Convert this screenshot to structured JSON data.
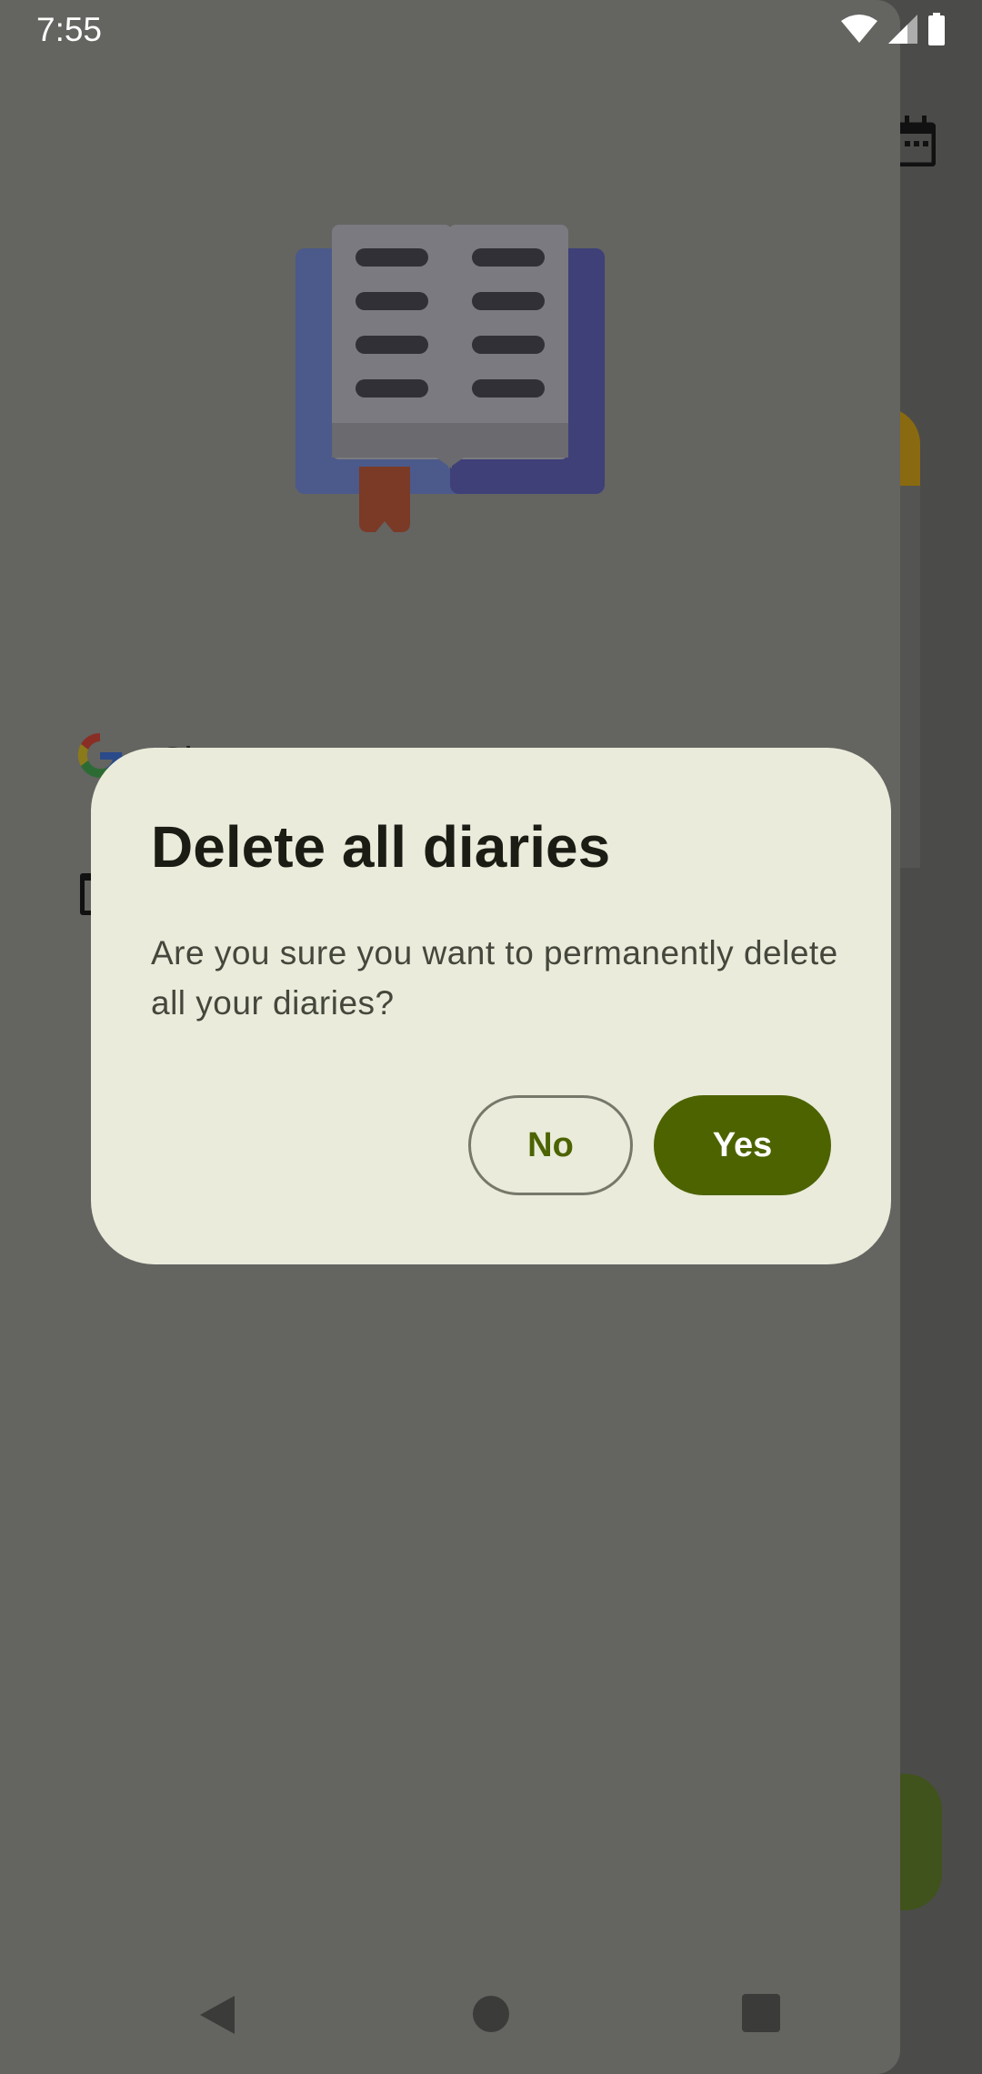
{
  "status_bar": {
    "time": "7:55",
    "icons": [
      "wifi-icon",
      "cell-signal-icon",
      "battery-icon"
    ]
  },
  "drawer": {
    "signout_label": "Sign out"
  },
  "dialog": {
    "title": "Delete all diaries",
    "message": "Are you sure you want to permanently delete all your diaries?",
    "no_label": "No",
    "yes_label": "Yes"
  },
  "nav_bar": {
    "icons": [
      "back-icon",
      "home-icon",
      "recents-icon"
    ]
  },
  "colors": {
    "scrim": "#646461",
    "dialog_bg": "#eaebda",
    "primary": "#4c6300",
    "title_text": "#1b1c14",
    "body_text": "#45473c"
  }
}
